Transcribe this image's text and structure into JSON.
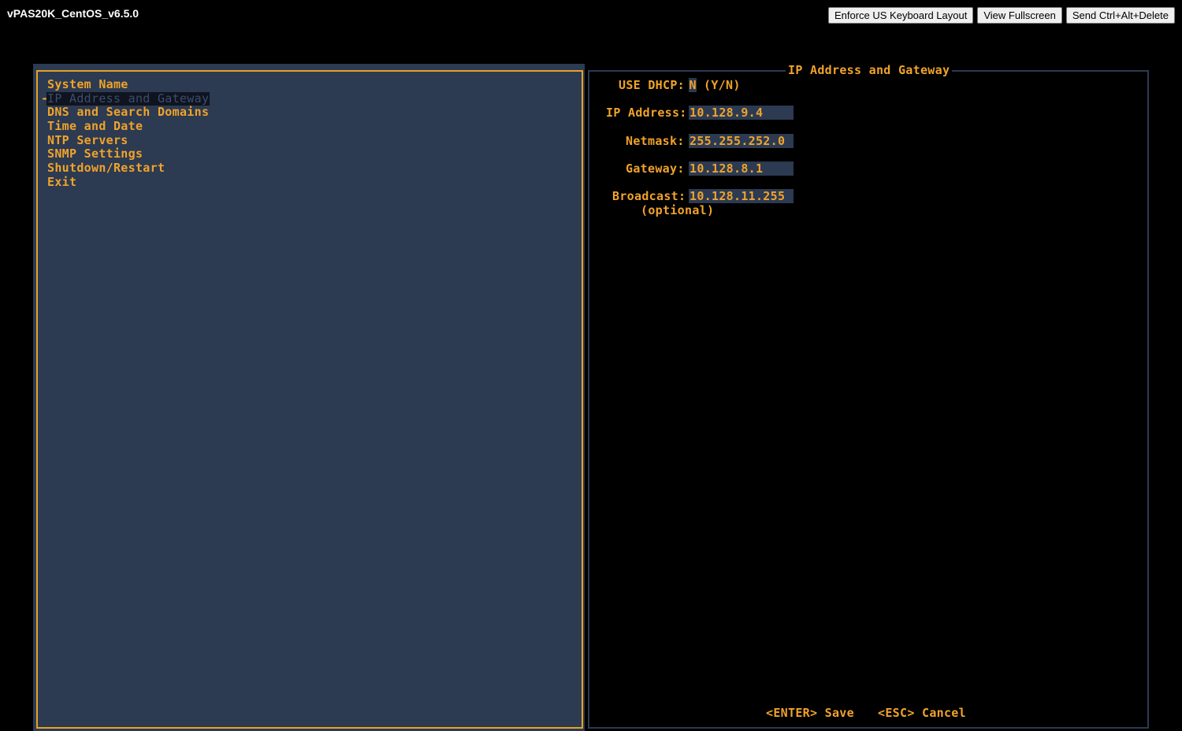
{
  "window": {
    "title": "vPAS20K_CentOS_v6.5.0"
  },
  "toolbar": {
    "enforce_keyboard_label": "Enforce US Keyboard Layout",
    "fullscreen_label": "View Fullscreen",
    "ctrl_alt_del_label": "Send Ctrl+Alt+Delete"
  },
  "menu": {
    "items": [
      {
        "label": "System Name"
      },
      {
        "label": "IP Address and Gateway",
        "selected": true
      },
      {
        "label": "DNS and Search Domains"
      },
      {
        "label": "Time and Date"
      },
      {
        "label": "NTP Servers"
      },
      {
        "label": "SNMP Settings"
      },
      {
        "label": "Shutdown/Restart"
      },
      {
        "label": "Exit"
      }
    ],
    "selected_marker": "-"
  },
  "dialog": {
    "title": "IP Address and Gateway",
    "dhcp": {
      "label": "USE DHCP:",
      "value": "N",
      "hint": "(Y/N)"
    },
    "ip_address": {
      "label": "IP Address:",
      "value": "10.128.9.4"
    },
    "netmask": {
      "label": "Netmask:",
      "value": "255.255.252.0"
    },
    "gateway": {
      "label": "Gateway:",
      "value": "10.128.8.1"
    },
    "broadcast": {
      "label": "Broadcast:",
      "value": "10.128.11.255",
      "note": "(optional)"
    },
    "footer": {
      "save": "<ENTER> Save",
      "cancel": "<ESC> Cancel"
    }
  },
  "colors": {
    "accent": "#f0a32a",
    "panel_bg": "#2c3a52",
    "background": "#000000"
  }
}
